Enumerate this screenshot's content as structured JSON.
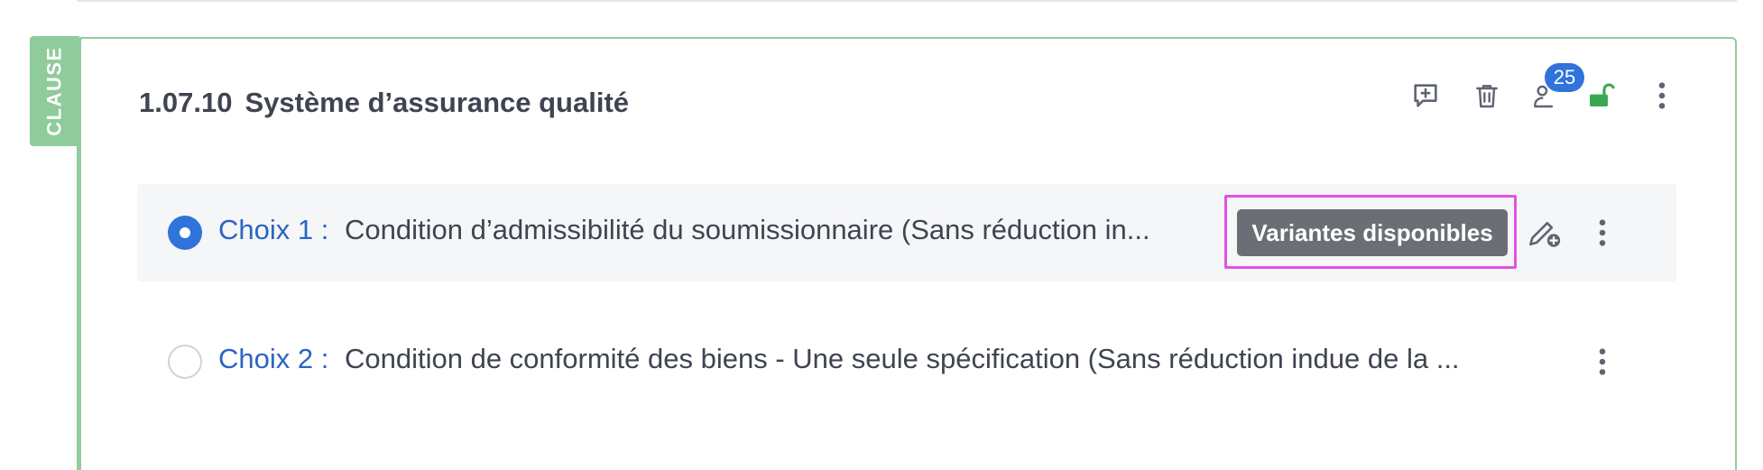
{
  "clause": {
    "tab_label": "CLAUSE",
    "number": "1.07.10",
    "title": "Système d’assurance qualité",
    "notification_count": "25",
    "accent_color": "#8fcb9b"
  },
  "toolbar": {
    "icons": [
      "add-comment-icon",
      "trash-icon",
      "user-assign-icon",
      "unlock-icon",
      "more-vertical-icon"
    ]
  },
  "choices": [
    {
      "label": "Choix 1 :",
      "text": "Condition d’admissibilité du soumissionnaire (Sans réduction in...",
      "selected": true,
      "variant_badge": "Variantes disponibles"
    },
    {
      "label": "Choix 2 :",
      "text": "Condition de conformité des biens - Une seule spécification (Sans réduction indue de la ...",
      "selected": false
    }
  ]
}
